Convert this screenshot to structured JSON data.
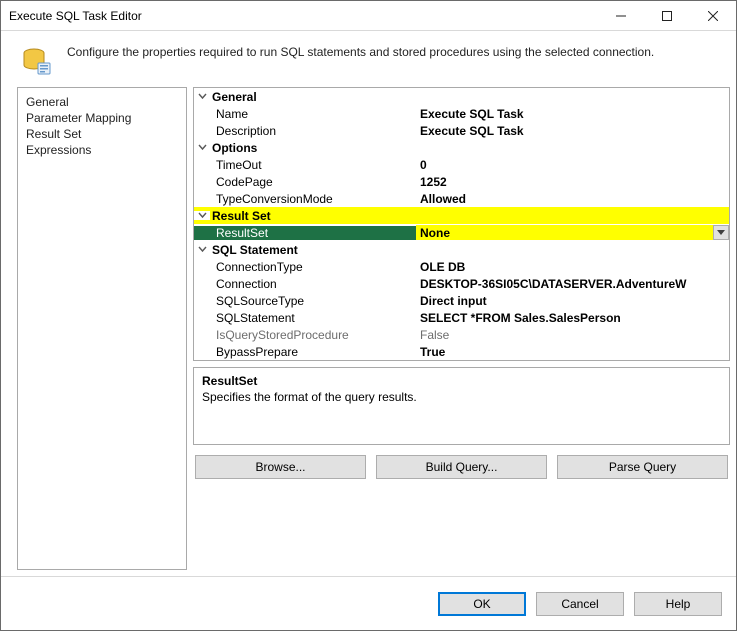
{
  "window": {
    "title": "Execute SQL Task Editor"
  },
  "header": {
    "text": "Configure the properties required to run SQL statements and stored procedures using the selected connection."
  },
  "sidebar": {
    "items": [
      {
        "label": "General"
      },
      {
        "label": "Parameter Mapping"
      },
      {
        "label": "Result Set"
      },
      {
        "label": "Expressions"
      }
    ]
  },
  "grid": {
    "categories": [
      {
        "label": "General",
        "rows": [
          {
            "name": "Name",
            "value": "Execute SQL Task"
          },
          {
            "name": "Description",
            "value": "Execute SQL Task"
          }
        ]
      },
      {
        "label": "Options",
        "rows": [
          {
            "name": "TimeOut",
            "value": "0"
          },
          {
            "name": "CodePage",
            "value": "1252"
          },
          {
            "name": "TypeConversionMode",
            "value": "Allowed"
          }
        ]
      },
      {
        "label": "Result Set",
        "highlighted": true,
        "rows": [
          {
            "name": "ResultSet",
            "value": "None",
            "selected": true
          }
        ]
      },
      {
        "label": "SQL Statement",
        "rows": [
          {
            "name": "ConnectionType",
            "value": "OLE DB"
          },
          {
            "name": "Connection",
            "value": "DESKTOP-36SI05C\\DATASERVER.AdventureW"
          },
          {
            "name": "SQLSourceType",
            "value": "Direct input"
          },
          {
            "name": "SQLStatement",
            "value": "SELECT    *FROM         Sales.SalesPerson"
          },
          {
            "name": "IsQueryStoredProcedure",
            "value": "False",
            "disabled": true
          },
          {
            "name": "BypassPrepare",
            "value": "True"
          }
        ]
      }
    ]
  },
  "help": {
    "title": "ResultSet",
    "desc": "Specifies the format of the query results."
  },
  "actions": {
    "browse": "Browse...",
    "build": "Build Query...",
    "parse": "Parse Query"
  },
  "footer": {
    "ok": "OK",
    "cancel": "Cancel",
    "help": "Help"
  }
}
